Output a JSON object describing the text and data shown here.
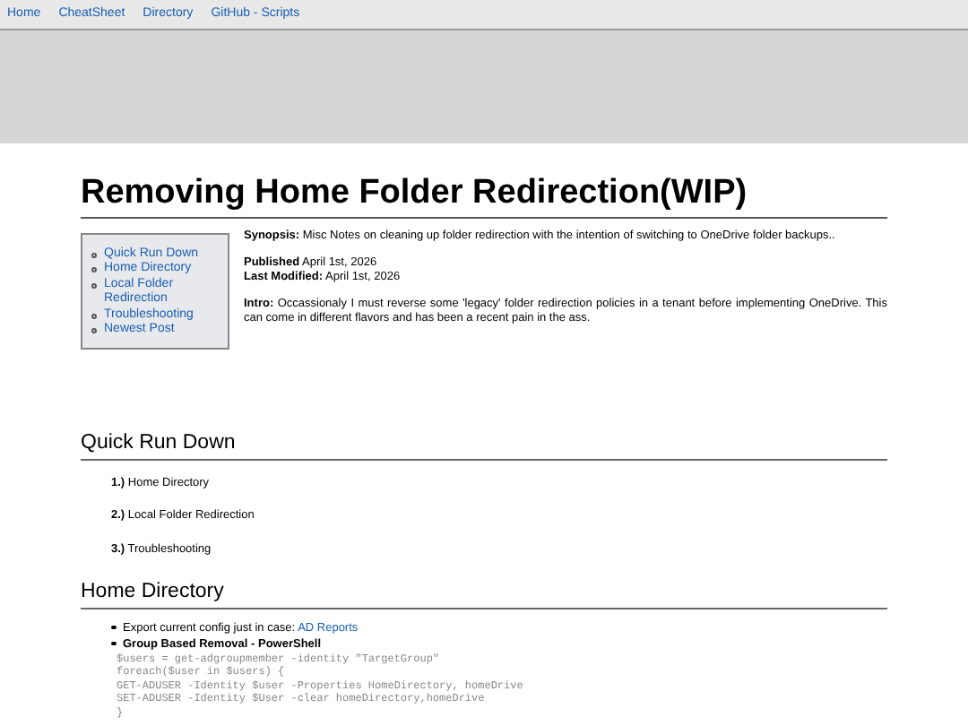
{
  "nav": [
    {
      "label": "Home"
    },
    {
      "label": "CheatSheet"
    },
    {
      "label": "Directory"
    },
    {
      "label": "GitHub - Scripts"
    }
  ],
  "title": "Removing Home Folder Redirection(WIP)",
  "toc": [
    {
      "label": "Quick Run Down"
    },
    {
      "label": "Home Directory"
    },
    {
      "label": "Local Folder Redirection"
    },
    {
      "label": "Troubleshooting"
    },
    {
      "label": "Newest Post"
    }
  ],
  "synopsis": "**Synopsis:** Misc Notes on cleaning up folder redirection with the intention of switching to OneDrive folder backups..",
  "published": "**Published** April 1st, 2026",
  "modified": "**Last Modified:** April 1st, 2026",
  "intro": "**Intro:** Occassionaly I must reverse some 'legacy' folder redirection policies in a tenant before implementing OneDrive. This can come in different flavors and has been a recent pain in the ass.",
  "sections": [
    {
      "heading": "Quick Run Down",
      "steps": [
        "**1.)** Home Directory",
        "**2.)** Local Folder Redirection",
        "**3.)** Troubleshooting"
      ]
    },
    {
      "heading": "Home Directory",
      "bullets": [
        {
          "text": "Export current config just in case: ",
          "link": "AD Reports"
        },
        {
          "text": "Group Based Removal - PowerShell",
          "bold": true
        }
      ],
      "code": [
        "$users = get-adgroupmember -identity \"TargetGroup\"",
        "foreach($user in $users) {",
        "GET-ADUSER -Identity $user -Properties HomeDirectory, homeDrive",
        "SET-ADUSER -Identity $User -clear homeDirectory,homeDrive",
        "}"
      ]
    }
  ]
}
